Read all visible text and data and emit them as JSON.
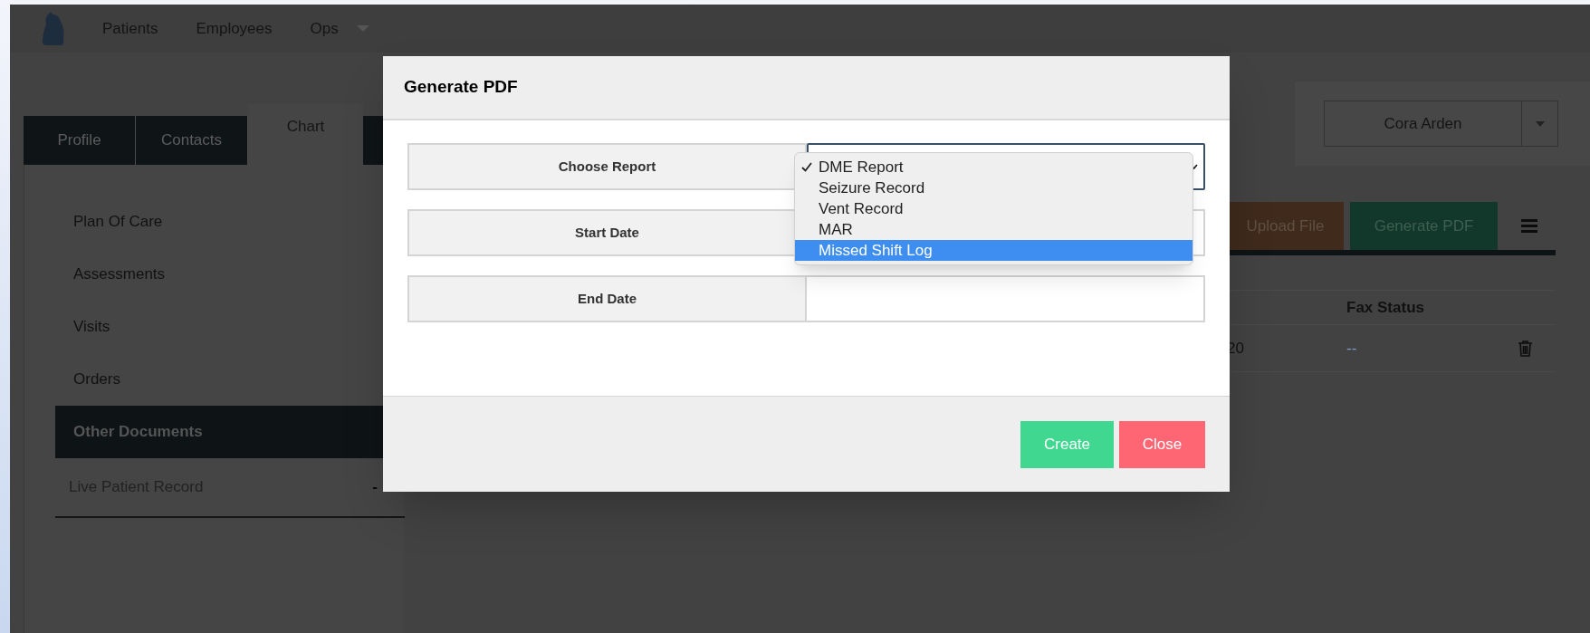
{
  "nav": {
    "items": [
      {
        "label": "Patients",
        "kind": "link"
      },
      {
        "label": "Employees",
        "kind": "link"
      },
      {
        "label": "Ops",
        "kind": "menu"
      }
    ]
  },
  "tabs": [
    {
      "label": "Profile",
      "selected": false
    },
    {
      "label": "Contacts",
      "selected": false
    },
    {
      "label": "Chart",
      "selected": true
    }
  ],
  "sidebar": {
    "items": [
      {
        "label": "Plan Of Care",
        "selected": false
      },
      {
        "label": "Assessments",
        "selected": false
      },
      {
        "label": "Visits",
        "selected": false
      },
      {
        "label": "Orders",
        "selected": false
      },
      {
        "label": "Other Documents",
        "selected": true
      }
    ],
    "record": {
      "label": "Live Patient Record",
      "value": "-"
    }
  },
  "patient_select": {
    "value": "Cora Arden"
  },
  "actions": [
    {
      "label": "Upload File",
      "kind": "upload"
    },
    {
      "label": "Generate PDF",
      "kind": "generate"
    }
  ],
  "table": {
    "columns": [
      {
        "label": "Fax Status"
      }
    ],
    "rows": [
      {
        "column_1": "20",
        "fax_status": "--"
      }
    ]
  },
  "modal": {
    "title": "Generate PDF",
    "fields": [
      {
        "label": "Choose Report",
        "kind": "select"
      },
      {
        "label": "Start Date",
        "kind": "date"
      },
      {
        "label": "End Date",
        "kind": "date"
      }
    ],
    "dropdown": {
      "options": [
        {
          "label": "DME Report",
          "checked": true,
          "selected": false
        },
        {
          "label": "Seizure Record",
          "checked": false,
          "selected": false
        },
        {
          "label": "Vent Record",
          "checked": false,
          "selected": false
        },
        {
          "label": "MAR",
          "checked": false,
          "selected": false
        },
        {
          "label": "Missed Shift Log",
          "checked": false,
          "selected": true
        }
      ]
    },
    "buttons": [
      {
        "label": "Create",
        "kind": "primary"
      },
      {
        "label": "Close",
        "kind": "danger"
      }
    ]
  }
}
